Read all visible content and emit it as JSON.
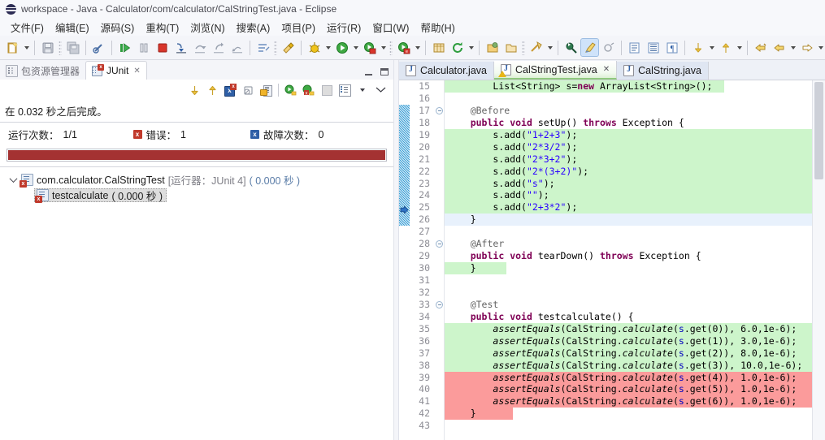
{
  "window": {
    "title": "workspace - Java - Calculator/com/calculator/CalStringTest.java - Eclipse",
    "logo_icon": "eclipse-logo"
  },
  "menubar": {
    "items": [
      {
        "label": "文件(F)"
      },
      {
        "label": "编辑(E)"
      },
      {
        "label": "源码(S)"
      },
      {
        "label": "重构(T)"
      },
      {
        "label": "浏览(N)"
      },
      {
        "label": "搜索(A)"
      },
      {
        "label": "项目(P)"
      },
      {
        "label": "运行(R)"
      },
      {
        "label": "窗口(W)"
      },
      {
        "label": "帮助(H)"
      }
    ]
  },
  "toolbar": {
    "buttons": [
      {
        "icon": "new-wizard-icon",
        "has_arrow": true
      },
      {
        "icon": "save-icon",
        "has_arrow": false
      },
      {
        "icon": "save-all-icon",
        "has_arrow": false
      },
      {
        "icon": "quick-fix-icon",
        "has_arrow": false
      },
      {
        "icon": "resume-icon",
        "has_arrow": false
      },
      {
        "icon": "suspend-icon",
        "has_arrow": false
      },
      {
        "icon": "terminate-icon",
        "has_arrow": false
      },
      {
        "icon": "step-into-icon",
        "has_arrow": false
      },
      {
        "icon": "step-over-icon",
        "has_arrow": false
      },
      {
        "icon": "step-return-icon",
        "has_arrow": false
      },
      {
        "icon": "drop-to-frame-icon",
        "has_arrow": false
      },
      {
        "icon": "skip-breakpoints-icon",
        "has_arrow": false
      },
      {
        "icon": "annotation-icon",
        "has_arrow": false
      },
      {
        "icon": "debug-icon",
        "has_arrow": true
      },
      {
        "icon": "run-icon",
        "has_arrow": true
      },
      {
        "icon": "coverage-icon",
        "has_arrow": true
      },
      {
        "icon": "external-tools-icon",
        "has_arrow": true
      },
      {
        "icon": "new-java-package-icon",
        "has_arrow": false
      },
      {
        "icon": "refresh-icon",
        "has_arrow": true
      },
      {
        "icon": "open-type-icon",
        "has_arrow": false
      },
      {
        "icon": "open-task-icon",
        "has_arrow": false
      },
      {
        "icon": "search-icon",
        "has_arrow": true
      },
      {
        "icon": "pin-editor-icon",
        "has_arrow": false
      },
      {
        "icon": "highlight-icon",
        "has_arrow": false,
        "selected": true
      },
      {
        "icon": "toggle-mark-occurrences-icon",
        "has_arrow": false
      },
      {
        "icon": "show-whitespace-icon",
        "has_arrow": false
      },
      {
        "icon": "show-source-icon",
        "has_arrow": false
      },
      {
        "icon": "show-formatting-icon",
        "has_arrow": false
      },
      {
        "icon": "next-annotation-icon",
        "has_arrow": true
      },
      {
        "icon": "previous-annotation-icon",
        "has_arrow": true
      },
      {
        "icon": "last-edit-location-icon",
        "has_arrow": false
      },
      {
        "icon": "back-icon",
        "has_arrow": true
      },
      {
        "icon": "forward-icon",
        "has_arrow": true
      }
    ]
  },
  "junit_view": {
    "tabs": [
      {
        "label": "包资源管理器",
        "icon": "package-explorer-icon",
        "active": false,
        "closable": false
      },
      {
        "label": "JUnit",
        "icon": "junit-icon",
        "active": true,
        "closable": true
      }
    ],
    "close_glyph": "✕",
    "window_controls": [
      {
        "name": "minimize-view-button",
        "icon": "minimize-icon"
      },
      {
        "name": "maximize-view-button",
        "icon": "maximize-icon"
      }
    ],
    "toolbar_buttons": [
      {
        "icon": "next-failure-icon"
      },
      {
        "icon": "previous-failure-icon"
      },
      {
        "icon": "show-failures-only-icon"
      },
      {
        "icon": "stop-junit-icon"
      },
      {
        "icon": "scroll-lock-icon"
      },
      {
        "icon": "rerun-test-icon"
      },
      {
        "icon": "rerun-failed-tests-icon"
      },
      {
        "icon": "history-icon"
      },
      {
        "icon": "view-menu-list-icon"
      },
      {
        "icon": "view-menu-arrow-icon"
      },
      {
        "icon": "view-menu-chevron-icon"
      }
    ],
    "status_text": "在 0.032 秒之后完成。",
    "counters": {
      "runs_label": "运行次数：",
      "runs_value": "1/1",
      "errors_label": "错误：",
      "errors_value": "1",
      "errors_icon": "error-badge-icon",
      "failures_label": "故障次数：",
      "failures_value": "0",
      "failures_icon": "failure-badge-icon"
    },
    "progress": {
      "percent": 100,
      "color": "#a43232",
      "state": "failed"
    },
    "tree": {
      "root": {
        "expanded": true,
        "label": "com.calculator.CalStringTest",
        "runner": "[运行器：JUnit 4]",
        "duration": "( 0.000 秒 )",
        "icon": "test-class-error-icon"
      },
      "children": [
        {
          "label": "testcalculate",
          "duration": "( 0.000 秒 )",
          "icon": "test-method-error-icon",
          "selected": true
        }
      ]
    }
  },
  "editor": {
    "tabs": [
      {
        "label": "Calculator.java",
        "icon": "java-file-icon",
        "active": false,
        "closable": false,
        "warning": false
      },
      {
        "label": "CalStringTest.java",
        "icon": "java-file-warning-icon",
        "active": true,
        "closable": true,
        "warning": true
      },
      {
        "label": "CalString.java",
        "icon": "java-file-icon",
        "active": false,
        "closable": false,
        "warning": false
      }
    ],
    "close_glyph": "✕",
    "first_line_number": 15,
    "lines": [
      {
        "n": 15,
        "hl": "green",
        "fold": null,
        "changed": false,
        "arrow": false,
        "tokens": [
          {
            "t": "        ",
            "c": ""
          },
          {
            "t": "List",
            "c": ""
          },
          {
            "t": "<String> s=",
            "c": ""
          },
          {
            "t": "new",
            "c": "kw"
          },
          {
            "t": " ArrayList<String>();",
            "c": ""
          }
        ]
      },
      {
        "n": 16,
        "hl": "none",
        "fold": null,
        "changed": false,
        "arrow": false,
        "tokens": []
      },
      {
        "n": 17,
        "hl": "none",
        "fold": "minus",
        "changed": true,
        "arrow": false,
        "tokens": [
          {
            "t": "    ",
            "c": ""
          },
          {
            "t": "@Before",
            "c": "ann"
          }
        ]
      },
      {
        "n": 18,
        "hl": "none",
        "fold": null,
        "changed": true,
        "arrow": false,
        "tokens": [
          {
            "t": "    ",
            "c": ""
          },
          {
            "t": "public",
            "c": "kw"
          },
          {
            "t": " ",
            "c": ""
          },
          {
            "t": "void",
            "c": "kw"
          },
          {
            "t": " setUp() ",
            "c": ""
          },
          {
            "t": "throws",
            "c": "kw"
          },
          {
            "t": " Exception {",
            "c": ""
          }
        ]
      },
      {
        "n": 19,
        "hl": "green",
        "fold": null,
        "changed": true,
        "arrow": false,
        "tokens": [
          {
            "t": "        s.add(",
            "c": ""
          },
          {
            "t": "\"1+2+3\"",
            "c": "str"
          },
          {
            "t": ");",
            "c": ""
          }
        ]
      },
      {
        "n": 20,
        "hl": "green",
        "fold": null,
        "changed": true,
        "arrow": false,
        "tokens": [
          {
            "t": "        s.add(",
            "c": ""
          },
          {
            "t": "\"2*3/2\"",
            "c": "str"
          },
          {
            "t": ");",
            "c": ""
          }
        ]
      },
      {
        "n": 21,
        "hl": "green",
        "fold": null,
        "changed": true,
        "arrow": false,
        "tokens": [
          {
            "t": "        s.add(",
            "c": ""
          },
          {
            "t": "\"2*3+2\"",
            "c": "str"
          },
          {
            "t": ");",
            "c": ""
          }
        ]
      },
      {
        "n": 22,
        "hl": "green",
        "fold": null,
        "changed": true,
        "arrow": false,
        "tokens": [
          {
            "t": "        s.add(",
            "c": ""
          },
          {
            "t": "\"2*(3+2)\"",
            "c": "str"
          },
          {
            "t": ");",
            "c": ""
          }
        ]
      },
      {
        "n": 23,
        "hl": "green",
        "fold": null,
        "changed": true,
        "arrow": false,
        "tokens": [
          {
            "t": "        s.add(",
            "c": ""
          },
          {
            "t": "\"s\"",
            "c": "str"
          },
          {
            "t": ");",
            "c": ""
          }
        ]
      },
      {
        "n": 24,
        "hl": "green",
        "fold": null,
        "changed": true,
        "arrow": false,
        "tokens": [
          {
            "t": "        s.add(",
            "c": ""
          },
          {
            "t": "\"\"",
            "c": "str"
          },
          {
            "t": ");",
            "c": ""
          }
        ]
      },
      {
        "n": 25,
        "hl": "green",
        "fold": null,
        "changed": true,
        "arrow": true,
        "tokens": [
          {
            "t": "        s.add(",
            "c": ""
          },
          {
            "t": "\"2+3*2\"",
            "c": "str"
          },
          {
            "t": ");",
            "c": ""
          }
        ]
      },
      {
        "n": 26,
        "hl": "blue",
        "fold": null,
        "changed": true,
        "arrow": false,
        "tokens": [
          {
            "t": "    }",
            "c": ""
          }
        ]
      },
      {
        "n": 27,
        "hl": "none",
        "fold": null,
        "changed": false,
        "arrow": false,
        "tokens": []
      },
      {
        "n": 28,
        "hl": "none",
        "fold": "minus",
        "changed": false,
        "arrow": false,
        "tokens": [
          {
            "t": "    ",
            "c": ""
          },
          {
            "t": "@After",
            "c": "ann"
          }
        ]
      },
      {
        "n": 29,
        "hl": "none",
        "fold": null,
        "changed": false,
        "arrow": false,
        "tokens": [
          {
            "t": "    ",
            "c": ""
          },
          {
            "t": "public",
            "c": "kw"
          },
          {
            "t": " ",
            "c": ""
          },
          {
            "t": "void",
            "c": "kw"
          },
          {
            "t": " tearDown() ",
            "c": ""
          },
          {
            "t": "throws",
            "c": "kw"
          },
          {
            "t": " Exception {",
            "c": ""
          }
        ]
      },
      {
        "n": 30,
        "hl": "green",
        "fold": null,
        "changed": false,
        "arrow": false,
        "tokens": [
          {
            "t": "    }",
            "c": ""
          }
        ]
      },
      {
        "n": 31,
        "hl": "none",
        "fold": null,
        "changed": false,
        "arrow": false,
        "tokens": []
      },
      {
        "n": 32,
        "hl": "none",
        "fold": null,
        "changed": false,
        "arrow": false,
        "tokens": []
      },
      {
        "n": 33,
        "hl": "none",
        "fold": "minus",
        "changed": false,
        "arrow": false,
        "tokens": [
          {
            "t": "    ",
            "c": ""
          },
          {
            "t": "@Test",
            "c": "ann"
          }
        ]
      },
      {
        "n": 34,
        "hl": "none",
        "fold": null,
        "changed": false,
        "arrow": false,
        "tokens": [
          {
            "t": "    ",
            "c": ""
          },
          {
            "t": "public",
            "c": "kw"
          },
          {
            "t": " ",
            "c": ""
          },
          {
            "t": "void",
            "c": "kw"
          },
          {
            "t": " testcalculate() {",
            "c": ""
          }
        ]
      },
      {
        "n": 35,
        "hl": "green",
        "fold": null,
        "changed": false,
        "arrow": false,
        "tokens": [
          {
            "t": "        ",
            "c": ""
          },
          {
            "t": "assertEquals",
            "c": "stm"
          },
          {
            "t": "(CalString.",
            "c": ""
          },
          {
            "t": "calculate",
            "c": "stm"
          },
          {
            "t": "(",
            "c": ""
          },
          {
            "t": "s",
            "c": "fld"
          },
          {
            "t": ".get(0)), 6.0,1e-6);",
            "c": ""
          }
        ]
      },
      {
        "n": 36,
        "hl": "green",
        "fold": null,
        "changed": false,
        "arrow": false,
        "tokens": [
          {
            "t": "        ",
            "c": ""
          },
          {
            "t": "assertEquals",
            "c": "stm"
          },
          {
            "t": "(CalString.",
            "c": ""
          },
          {
            "t": "calculate",
            "c": "stm"
          },
          {
            "t": "(",
            "c": ""
          },
          {
            "t": "s",
            "c": "fld"
          },
          {
            "t": ".get(1)), 3.0,1e-6);",
            "c": ""
          }
        ]
      },
      {
        "n": 37,
        "hl": "green",
        "fold": null,
        "changed": false,
        "arrow": false,
        "tokens": [
          {
            "t": "        ",
            "c": ""
          },
          {
            "t": "assertEquals",
            "c": "stm"
          },
          {
            "t": "(CalString.",
            "c": ""
          },
          {
            "t": "calculate",
            "c": "stm"
          },
          {
            "t": "(",
            "c": ""
          },
          {
            "t": "s",
            "c": "fld"
          },
          {
            "t": ".get(2)), 8.0,1e-6);",
            "c": ""
          }
        ]
      },
      {
        "n": 38,
        "hl": "green",
        "fold": null,
        "changed": false,
        "arrow": false,
        "tokens": [
          {
            "t": "        ",
            "c": ""
          },
          {
            "t": "assertEquals",
            "c": "stm"
          },
          {
            "t": "(CalString.",
            "c": ""
          },
          {
            "t": "calculate",
            "c": "stm"
          },
          {
            "t": "(",
            "c": ""
          },
          {
            "t": "s",
            "c": "fld"
          },
          {
            "t": ".get(3)), 10.0,1e-6);",
            "c": ""
          }
        ]
      },
      {
        "n": 39,
        "hl": "red",
        "fold": null,
        "changed": false,
        "arrow": false,
        "tokens": [
          {
            "t": "        ",
            "c": ""
          },
          {
            "t": "assertEquals",
            "c": "stm"
          },
          {
            "t": "(CalString.",
            "c": ""
          },
          {
            "t": "calculate",
            "c": "stm"
          },
          {
            "t": "(",
            "c": ""
          },
          {
            "t": "s",
            "c": "fld"
          },
          {
            "t": ".get(4)), 1.0,1e-6);",
            "c": ""
          }
        ]
      },
      {
        "n": 40,
        "hl": "red",
        "fold": null,
        "changed": false,
        "arrow": false,
        "tokens": [
          {
            "t": "        ",
            "c": ""
          },
          {
            "t": "assertEquals",
            "c": "stm"
          },
          {
            "t": "(CalString.",
            "c": ""
          },
          {
            "t": "calculate",
            "c": "stm"
          },
          {
            "t": "(",
            "c": ""
          },
          {
            "t": "s",
            "c": "fld"
          },
          {
            "t": ".get(5)), 1.0,1e-6);",
            "c": ""
          }
        ]
      },
      {
        "n": 41,
        "hl": "red",
        "fold": null,
        "changed": false,
        "arrow": false,
        "tokens": [
          {
            "t": "        ",
            "c": ""
          },
          {
            "t": "assertEquals",
            "c": "stm"
          },
          {
            "t": "(CalString.",
            "c": ""
          },
          {
            "t": "calculate",
            "c": "stm"
          },
          {
            "t": "(",
            "c": ""
          },
          {
            "t": "s",
            "c": "fld"
          },
          {
            "t": ".get(6)), 1.0,1e-6);",
            "c": ""
          }
        ]
      },
      {
        "n": 42,
        "hl": "red-short",
        "fold": null,
        "changed": false,
        "arrow": false,
        "tokens": [
          {
            "t": "    }",
            "c": ""
          }
        ]
      },
      {
        "n": 43,
        "hl": "none",
        "fold": null,
        "changed": false,
        "arrow": false,
        "tokens": []
      }
    ]
  },
  "colors": {
    "coverage_covered": "#cdf5cb",
    "coverage_uncovered": "#fb9b9b",
    "current_line": "#e8f1fc",
    "progress_failed": "#a43232",
    "keyword": "#7f0055",
    "string": "#2a00ff",
    "annotation": "#646464",
    "field": "#0000c0"
  }
}
